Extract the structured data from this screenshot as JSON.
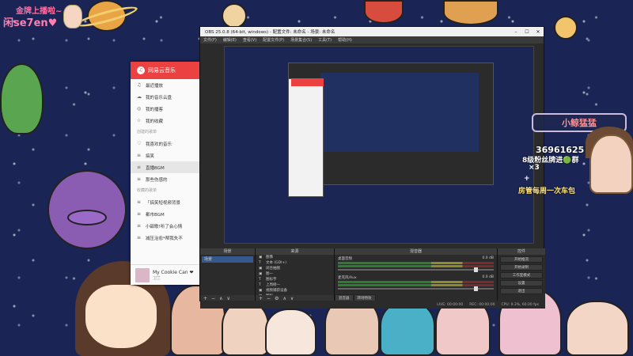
{
  "badge": {
    "line1": "金牌上播啦~",
    "line2": "闲se7en♥"
  },
  "music": {
    "app_name": "网易云音乐",
    "items": [
      {
        "icon": "♫",
        "label": "最近播放",
        "active": false
      },
      {
        "icon": "☁",
        "label": "我的音乐云盘",
        "active": false
      },
      {
        "icon": "◎",
        "label": "我的播客",
        "active": false
      },
      {
        "icon": "☆",
        "label": "我的收藏",
        "active": false
      }
    ],
    "section_created": "创建的歌单",
    "created": [
      {
        "icon": "♡",
        "label": "我喜欢的音乐",
        "active": false
      },
      {
        "icon": "≡",
        "label": "搞笑",
        "active": false
      },
      {
        "icon": "≡",
        "label": "直播BGM",
        "active": true
      },
      {
        "icon": "≡",
        "label": "那些伤感的",
        "active": false
      }
    ],
    "section_collected": "收藏的歌单",
    "collected": [
      {
        "icon": "≡",
        "label": "「搞笑短视频背景",
        "active": false
      },
      {
        "icon": "≡",
        "label": "都市BGM",
        "active": false
      },
      {
        "icon": "≡",
        "label": "小甜歌!听了会心情",
        "active": false
      },
      {
        "icon": "≡",
        "label": "减压治愈*帮我失不",
        "active": false
      }
    ],
    "now_playing": {
      "title": "My Cookie Can ❤",
      "artist": "卫兰"
    }
  },
  "obs": {
    "title": "OBS 25.0.8 (64-bit, windows) - 配置文件: 未命名 - 场景: 未命名",
    "menu": [
      "文件(F)",
      "编辑(E)",
      "查看(V)",
      "配置文件(P)",
      "场景集合(S)",
      "工具(T)",
      "帮助(H)"
    ],
    "docks": {
      "scenes": "场景",
      "sources": "来源",
      "mixer": "混音器",
      "controls": "控件"
    },
    "scene": "场景",
    "sources": [
      {
        "icon": "▣",
        "label": "图像"
      },
      {
        "icon": "T",
        "label": "文本 (GDI+)"
      },
      {
        "icon": "▣",
        "label": "闭合抽图"
      },
      {
        "icon": "▣",
        "label": "图一"
      },
      {
        "icon": "T",
        "label": "图标字"
      },
      {
        "icon": "T",
        "label": "上周榜一"
      },
      {
        "icon": "▣",
        "label": "视频捕获设备"
      },
      {
        "icon": "▣",
        "label": "图标"
      }
    ],
    "mixer": [
      {
        "name": "桌面音频",
        "db": "0.0 dB"
      },
      {
        "name": "麦克风/Aux",
        "db": "0.0 dB"
      }
    ],
    "mixer_tabs": [
      "混音器",
      "转场特效"
    ],
    "controls": [
      "开始推流",
      "开始录制",
      "工作室模式",
      "设置",
      "退出"
    ],
    "status": [
      "LIVE: 00:00:00",
      "REC: 00:00:00",
      "CPU: 9.3%, 60.00 fps"
    ]
  },
  "overlay": {
    "room_name": "小鲸猛猛",
    "room_id": "36961625",
    "fan_group": "8级粉丝牌进🟢群",
    "gift1": "×3",
    "gift2": "+",
    "schedule": "房管每周一次车包"
  }
}
